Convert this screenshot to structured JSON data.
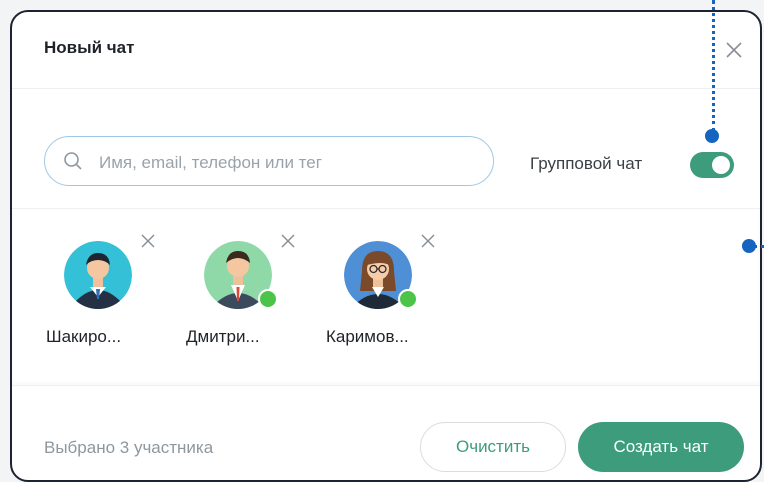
{
  "dialog": {
    "title": "Новый чат",
    "close_icon": "close-icon"
  },
  "search": {
    "placeholder": "Имя, email, телефон или тег",
    "value": "",
    "icon": "search-icon"
  },
  "group_toggle": {
    "label": "Групповой чат",
    "enabled": true,
    "color": "#3d9c7c"
  },
  "members": [
    {
      "name": "Шакиро...",
      "online": false,
      "avatar": "avatar-man-teal"
    },
    {
      "name": "Дмитри...",
      "online": true,
      "avatar": "avatar-man-green"
    },
    {
      "name": "Каримов...",
      "online": true,
      "avatar": "avatar-woman-blue"
    }
  ],
  "footer": {
    "selected_text": "Выбрано 3 участника",
    "clear_label": "Очистить",
    "create_label": "Создать чат"
  },
  "colors": {
    "accent": "#3d9c7c",
    "online": "#4cc44a",
    "annotation": "#1565c0"
  }
}
